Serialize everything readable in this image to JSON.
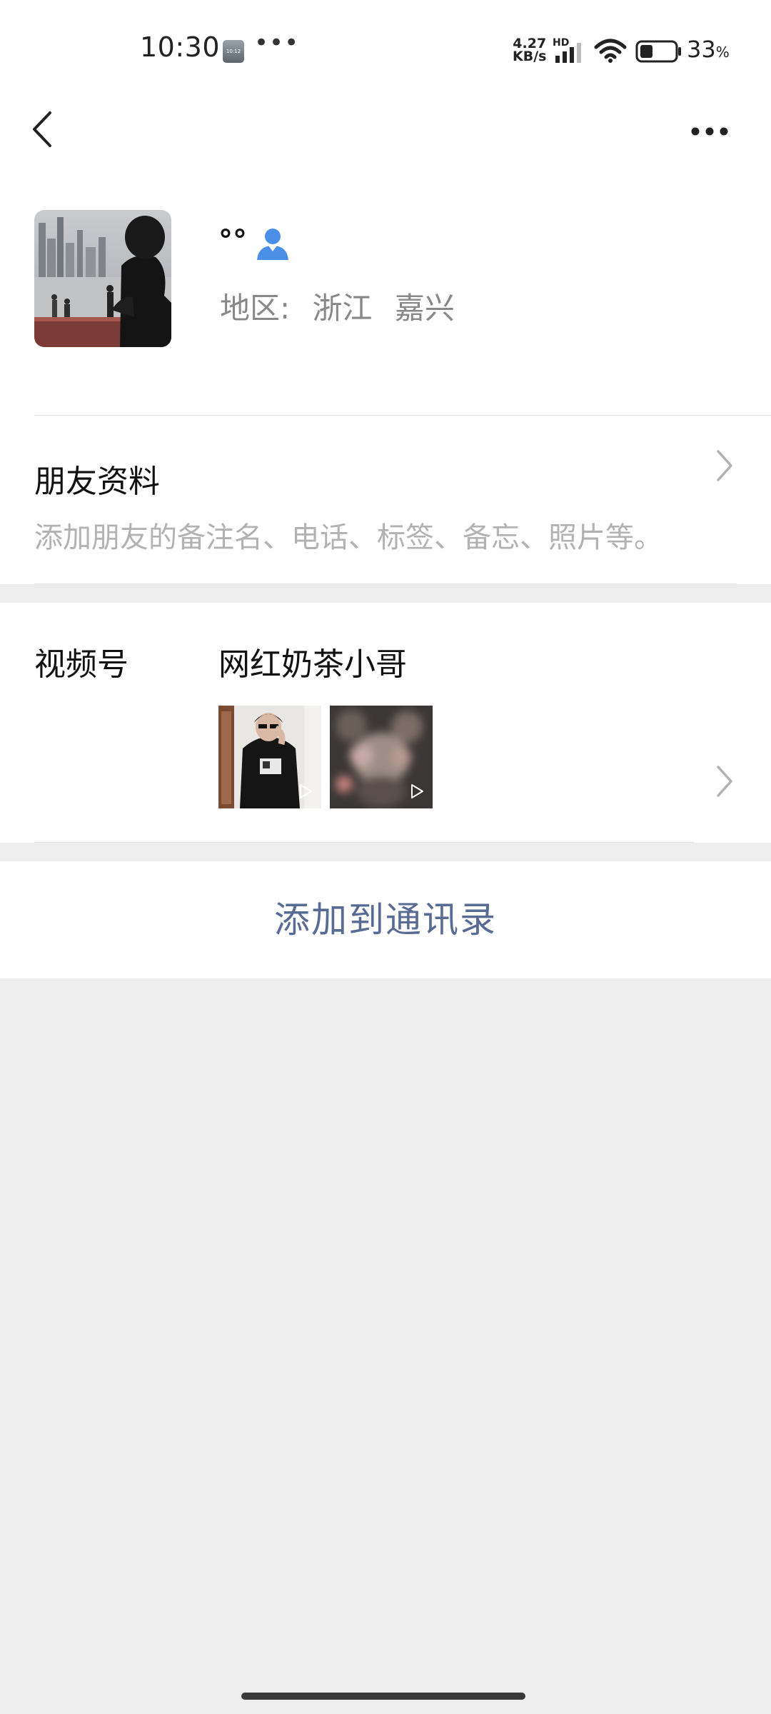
{
  "status_bar": {
    "time": "10:30",
    "thumb_label": "10:12",
    "dots": "•••",
    "speed_value": "4.27",
    "speed_unit": "KB/s",
    "network": "HD",
    "battery_percent": "33",
    "battery_unit": "%"
  },
  "nav": {
    "back_icon": "chevron-left-icon",
    "more_icon": "more-dots-icon"
  },
  "profile": {
    "nickname": "°°",
    "contact_icon": "person-icon",
    "region_label": "地区:",
    "region_province": "浙江",
    "region_city": "嘉兴"
  },
  "friend_info": {
    "title": "朋友资料",
    "description": "添加朋友的备注名、电话、标签、备忘、照片等。"
  },
  "channels": {
    "label": "视频号",
    "name": "网红奶茶小哥",
    "thumbnail_icons": [
      "play-icon",
      "play-icon"
    ]
  },
  "actions": {
    "add_to_contacts": "添加到通讯录"
  },
  "colors": {
    "link": "#576b95",
    "background": "#ededed",
    "secondary_text": "#888888",
    "hint_text": "#b2b2b2"
  }
}
